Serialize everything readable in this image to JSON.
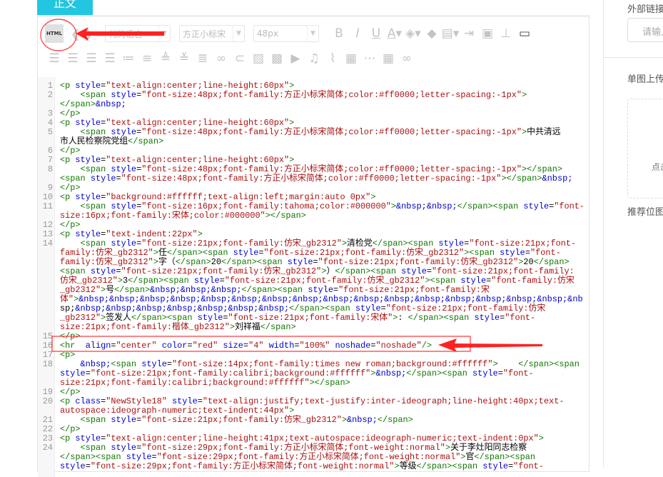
{
  "tab": {
    "label": "正文"
  },
  "toolbar": {
    "html_label": "HTML",
    "code_language": "代码语言",
    "font_family": "方正小标宋",
    "font_size": "48px"
  },
  "code_lines": [
    {
      "n": "1",
      "t": "<p style=\"text-align:center;line-height:60px\">"
    },
    {
      "n": "2",
      "t": "    <span style=\"font-size:48px;font-family:方正小标宋简体;color:#ff0000;letter-spacing:-1px\">"
    },
    {
      "n": "",
      "t": "</span>&nbsp;"
    },
    {
      "n": "3",
      "t": "</p>"
    },
    {
      "n": "4",
      "t": "<p style=\"text-align:center;line-height:60px\">"
    },
    {
      "n": "5",
      "t": "    <span style=\"font-size:48px;font-family:方正小标宋简体;color:#ff0000;letter-spacing:-1px\">中共清远"
    },
    {
      "n": "",
      "t": "市人民检察院党组</span>"
    },
    {
      "n": "6",
      "t": "</p>"
    },
    {
      "n": "7",
      "t": "<p style=\"text-align:center;line-height:60px\">"
    },
    {
      "n": "8",
      "t": "    <span style=\"font-size:48px;font-family:方正小标宋简体;color:#ff0000;letter-spacing:-1px\"></span>"
    },
    {
      "n": "",
      "t": "<span style=\"font-size:48px;font-family:方正小标宋简体;color:#ff0000;letter-spacing:-1px\"></span>&nbsp;"
    },
    {
      "n": "9",
      "t": "</p>"
    },
    {
      "n": "10",
      "t": "<p style=\"background:#ffffff;text-align:left;margin:auto 0px\">"
    },
    {
      "n": "11",
      "t": "    <span style=\"font-size:16px;font-family:tahoma;color:#000000\">&nbsp;&nbsp;</span><span style=\"font-"
    },
    {
      "n": "",
      "t": "size:16px;font-family:宋体;color:#000000\"></span>"
    },
    {
      "n": "12",
      "t": "</p>"
    },
    {
      "n": "13",
      "t": "<p style=\"text-indent:22px\">"
    },
    {
      "n": "14",
      "t": "    <span style=\"font-size:21px;font-family:仿宋_gb2312\">清检党</span><span style=\"font-size:21px;font-"
    },
    {
      "n": "",
      "t": "family:仿宋_gb2312\">任</span><span style=\"font-size:21px;font-family:仿宋_gb2312\"><span style=\"font-"
    },
    {
      "n": "",
      "t": "family:仿宋_gb2312\">字（</span>20</span><span style=\"font-size:21px;font-family:仿宋_gb2312\">20</span>"
    },
    {
      "n": "",
      "t": "<span style=\"font-size:21px;font-family:仿宋_gb2312\">）</span><span style=\"font-size:21px;font-family:"
    },
    {
      "n": "",
      "t": "仿宋_gb2312\">3</span><span style=\"font-size:21px;font-family:仿宋_gb2312\"><span style=\"font-family:仿宋"
    },
    {
      "n": "",
      "t": "_gb2312\">号</span>&nbsp;&nbsp;&nbsp;</span><span style=\"font-size:21px;font-family:宋"
    },
    {
      "n": "",
      "t": "体\">&nbsp;&nbsp;&nbsp;&nbsp;&nbsp;&nbsp;&nbsp;&nbsp;&nbsp;&nbsp;&nbsp;&nbsp;&nbsp;&nbsp;&nbsp;&nbsp;&nb"
    },
    {
      "n": "",
      "t": "sp;&nbsp;&nbsp;&nbsp;&nbsp;&nbsp;&nbsp;&nbsp;</span><span style=\"font-size:21px;font-family:仿宋"
    },
    {
      "n": "",
      "t": "_gb2312\">签发人</span><span style=\"font-size:21px;font-family:宋体\">: </span><span style=\"font-"
    },
    {
      "n": "",
      "t": "size:21px;font-family:楷体_gb2312\">刘祥福</span>"
    },
    {
      "n": "15",
      "t": "</p>"
    },
    {
      "n": "16",
      "t": "<hr  align=\"center\" color=\"red\" size=\"4\" width=\"100%\" noshade=\"noshade\"/>"
    },
    {
      "n": "17",
      "t": "<p>"
    },
    {
      "n": "18",
      "t": "    &nbsp;<span style=\"font-size:14px;font-family:times new roman;background:#ffffff\">    </span><span"
    },
    {
      "n": "",
      "t": "style=\"font-size:21px;font-family:calibri;background:#ffffff\">&nbsp;</span><span style=\"font-"
    },
    {
      "n": "",
      "t": "size:21px;font-family:calibri;background:#ffffff\"></span>"
    },
    {
      "n": "19",
      "t": "</p>"
    },
    {
      "n": "20",
      "t": "<p class=\"NewStyle18\" style=\"text-align:justify;text-justify:inter-ideograph;line-height:40px;text-"
    },
    {
      "n": "",
      "t": "autospace:ideograph-numeric;text-indent:44px\">"
    },
    {
      "n": "21",
      "t": "    <span style=\"font-size:21px;font-family:仿宋_gb2312\">&nbsp;</span>"
    },
    {
      "n": "22",
      "t": "</p>"
    },
    {
      "n": "23",
      "t": "<p style=\"text-align:center;line-height:41px;text-autospace:ideograph-numeric;text-indent:0px\">"
    },
    {
      "n": "24",
      "t": "    <span style=\"font-size:29px;font-family:方正小标宋简体;font-weight:normal\">关于李灶阳同志检察"
    },
    {
      "n": "",
      "t": "</span><span style=\"font-size:29px;font-family:方正小标宋简体;font-weight:normal\">官</span><span"
    },
    {
      "n": "",
      "t": "style=\"font-size:29px;font-family:方正小标宋简体;font-weight:normal\">等级</span><span style=\"font-"
    }
  ],
  "right_panel": {
    "external_link_label": "外部链接",
    "external_link_placeholder": "请输入",
    "single_upload_label": "单图上传",
    "upload_hint": "点击",
    "recommend_label": "推荐位图"
  },
  "colors": {
    "accent": "#23c6e0",
    "annotation": "#ff3333"
  }
}
